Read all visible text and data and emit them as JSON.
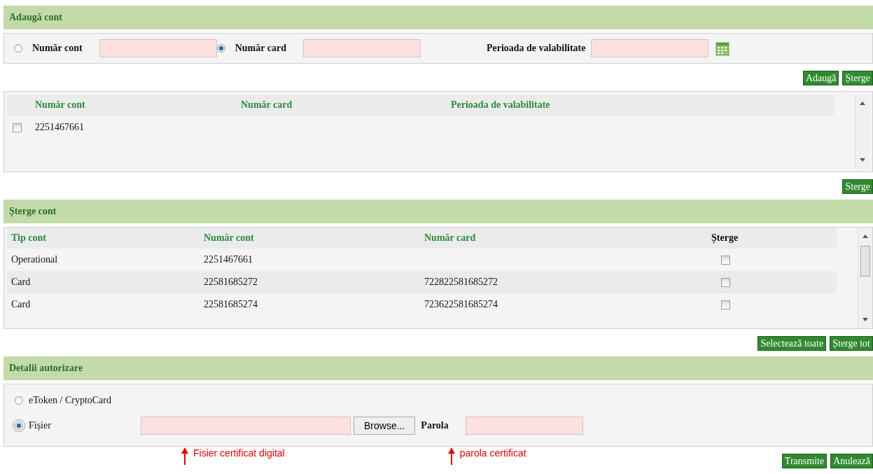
{
  "add_account": {
    "title": "Adaugă cont",
    "fields": [
      {
        "label": "Număr cont",
        "selected": false
      },
      {
        "label": "Număr card",
        "selected": true
      }
    ],
    "validity": {
      "label": "Perioada de valabilitate"
    },
    "buttons": [
      "Adaugă",
      "Șterge"
    ]
  },
  "pending_table": {
    "columns": [
      "Număr cont",
      "Număr card",
      "Perioada de valabilitate"
    ],
    "rows": [
      {
        "checked": false,
        "cells": [
          "2251467661",
          "",
          ""
        ]
      }
    ],
    "button": "Sterge"
  },
  "delete_account": {
    "title": "Șterge cont",
    "columns": [
      "Tip cont",
      "Număr cont",
      "Număr card",
      "Șterge"
    ],
    "rows": [
      {
        "cells": [
          "Operational",
          "2251467661",
          ""
        ],
        "checked": false
      },
      {
        "cells": [
          "Card",
          "22581685272",
          "722822581685272"
        ],
        "checked": false
      },
      {
        "cells": [
          "Card",
          "22581685274",
          "723622581685274"
        ],
        "checked": false
      }
    ],
    "buttons": [
      "Selectează toate",
      "Șterge tot"
    ]
  },
  "authorization": {
    "title": "Detalii autorizare",
    "options": [
      {
        "label": "eToken / CryptoCard",
        "selected": false
      },
      {
        "label": "Fișier",
        "selected": true
      }
    ],
    "browse": "Browse...",
    "password_label": "Parola",
    "annotations": [
      "Fisier certificat digital",
      "parola certificat"
    ],
    "buttons": [
      "Transmite",
      "Anulează"
    ]
  }
}
